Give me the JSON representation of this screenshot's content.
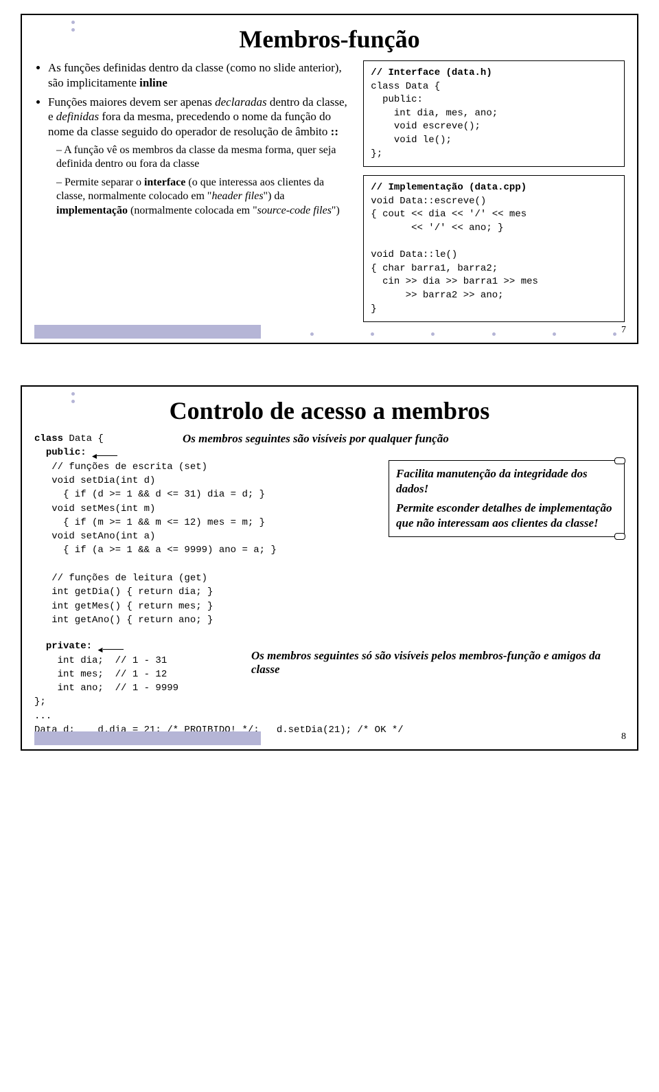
{
  "slide1": {
    "title": "Membros-função",
    "bullets": [
      {
        "pre": "As funções definidas dentro da classe (como no slide anterior), são implicitamente ",
        "bold1": "inline"
      },
      {
        "plain": "Funções maiores devem ser apenas ",
        "i1": "declaradas",
        "mid": " dentro da classe, e ",
        "i2": "definidas",
        "tail": " fora da mesma, precedendo o nome da função do nome da classe seguido do operador de resolução de âmbito ",
        "bold2": "::"
      }
    ],
    "dashes": [
      "A função vê os membros da classe da mesma forma, quer seja definida dentro ou fora da classe",
      {
        "pre": "Permite separar o ",
        "b": "interface",
        "mid": " (o que interessa aos clientes da classe, normalmente colocado em \"",
        "i1": "header files",
        "mid2": "\") da ",
        "b2": "implementação",
        "mid3": " (normalmente colocada em \"",
        "i2": "source-code files",
        "tail": "\")"
      }
    ],
    "code1_header": "// Interface (data.h)",
    "code1_body": "class Data {\n  public:\n    int dia, mes, ano;\n    void escreve();\n    void le();\n};",
    "code2_header": "// Implementação (data.cpp)",
    "code2_body": "void Data::escreve()\n{ cout << dia << '/' << mes\n       << '/' << ano; }\n\nvoid Data::le()\n{ char barra1, barra2;\n  cin >> dia >> barra1 >> mes\n      >> barra2 >> ano;\n}",
    "pagenum": "7"
  },
  "slide2": {
    "title": "Controlo de acesso a membros",
    "annot_public": "Os membros seguintes são visíveis por qualquer função",
    "code_top": "class Data {\n  public:",
    "code_mid": "   // funções de escrita (set)\n   void setDia(int d)\n     { if (d >= 1 && d <= 31) dia = d; }\n   void setMes(int m)\n     { if (m >= 1 && m <= 12) mes = m; }\n   void setAno(int a)\n     { if (a >= 1 && a <= 9999) ano = a; }\n\n   // funções de leitura (get)\n   int getDia() { return dia; }\n   int getMes() { return mes; }\n   int getAno() { return ano; }",
    "note_right": "Facilita manutenção da integridade dos dados!\nPermite esconder detalhes de implementação que não interessam aos clientes da classe!",
    "code_private": "  private:\n    int dia;  // 1 - 31\n    int mes;  // 1 - 12\n    int ano;  // 1 - 9999\n};\n...\nData d;    d.dia = 21; /* PROIBIDO! */;   d.setDia(21); /* OK */",
    "annot_private": "Os membros seguintes só são visíveis pelos membros-função e amigos da classe",
    "pagenum": "8"
  }
}
